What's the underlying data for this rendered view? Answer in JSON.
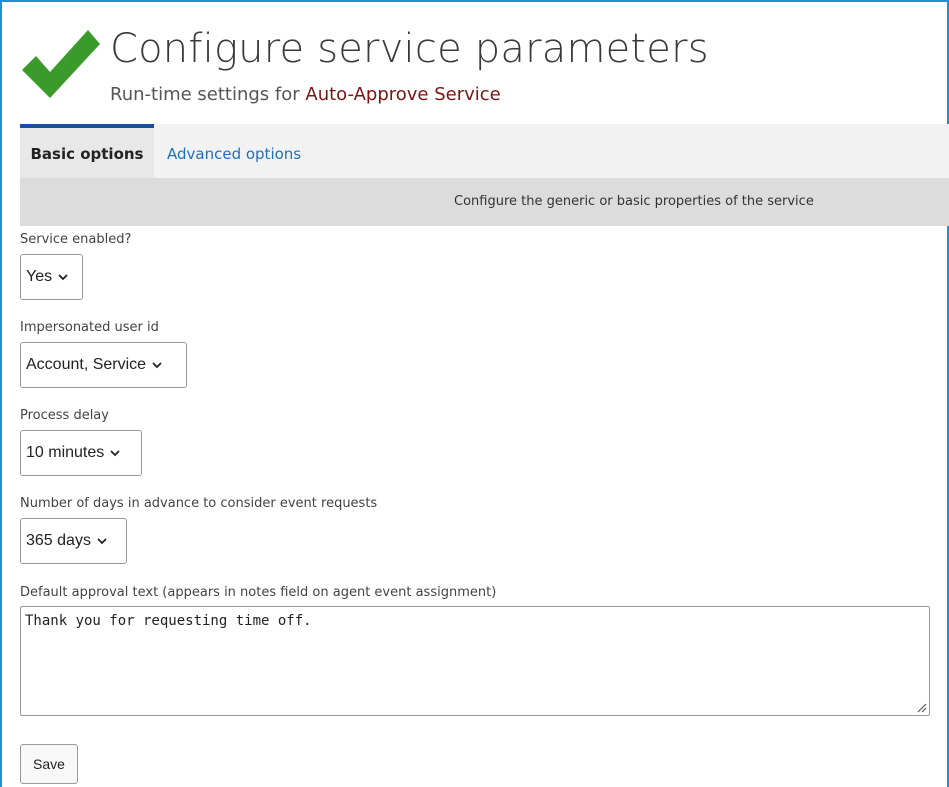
{
  "header": {
    "title": "Configure service parameters",
    "subtitle_prefix": "Run-time settings for ",
    "service_name": "Auto-Approve Service",
    "icon": "checkmark-icon",
    "icon_color": "#3a9a2a"
  },
  "tabs": [
    {
      "label": "Basic options",
      "active": true
    },
    {
      "label": "Advanced options",
      "active": false
    }
  ],
  "description": "Configure the generic or basic properties of the service",
  "fields": {
    "service_enabled": {
      "label": "Service enabled?",
      "value": "Yes"
    },
    "impersonated_user": {
      "label": "Impersonated user id",
      "value": "Account, Service"
    },
    "process_delay": {
      "label": "Process delay",
      "value": "10 minutes"
    },
    "days_in_advance": {
      "label": "Number of days in advance to consider event requests",
      "value": "365 days"
    },
    "approval_text": {
      "label": "Default approval text (appears in notes field on agent event assignment)",
      "value": "Thank you for requesting time off."
    }
  },
  "save_label": "Save",
  "colors": {
    "accent": "#1f8fd6",
    "tab_active_border": "#1a4fa0",
    "service_name": "#7a1414",
    "link": "#1f6fc1"
  }
}
